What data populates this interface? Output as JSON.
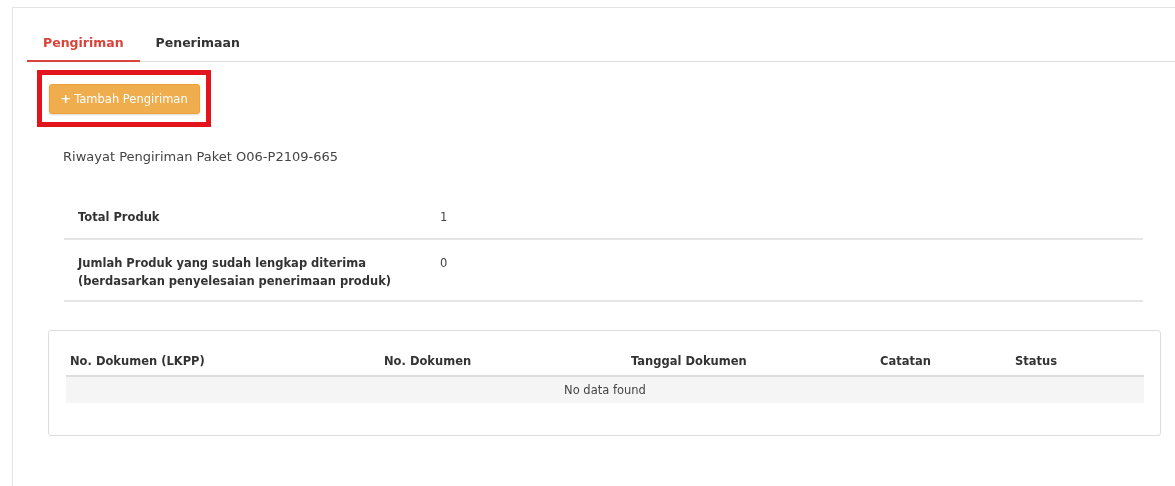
{
  "tabs": [
    {
      "label": "Pengiriman",
      "selected": true
    },
    {
      "label": "Penerimaan",
      "selected": false
    }
  ],
  "add_button": {
    "icon": "+",
    "label": "Tambah Pengiriman",
    "highlighted": true
  },
  "title": "Riwayat Pengiriman Paket O06-P2109-665",
  "summary": [
    {
      "label": "Total Produk",
      "value": "1"
    },
    {
      "label": "Jumlah Produk yang sudah lengkap diterima\n(berdasarkan penyelesaian penerimaan produk)",
      "value": "0"
    }
  ],
  "table": {
    "columns": [
      "No. Dokumen (LKPP)",
      "No. Dokumen",
      "Tanggal Dokumen",
      "Catatan",
      "Status"
    ],
    "empty_message": "No data found"
  }
}
